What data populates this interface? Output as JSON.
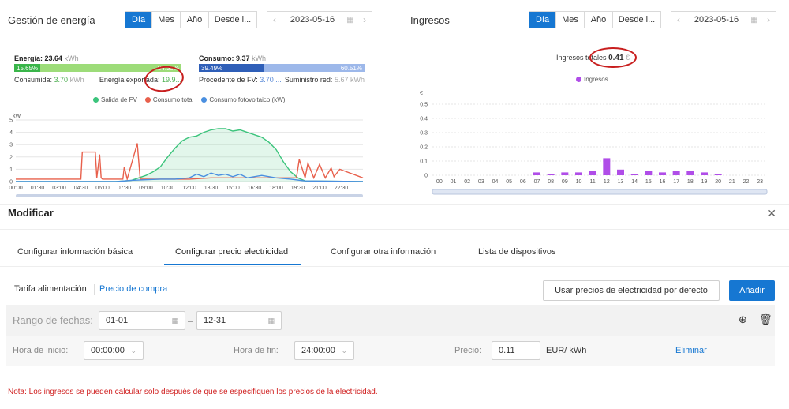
{
  "energy": {
    "title": "Gestión de energía",
    "period_tabs": [
      "Día",
      "Mes",
      "Año",
      "Desde i..."
    ],
    "active_tab": 0,
    "date": "2023-05-16",
    "energia_label": "Energía:",
    "energia_value": "23.64",
    "energia_unit": "kWh",
    "energia_bar_left": "15.65%",
    "energia_bar_right": "84.35%",
    "energia_bar_fraction": 0.1565,
    "consumida_label": "Consumida:",
    "consumida_value": "3.70",
    "consumida_unit": "kWh",
    "exportada_label": "Energía exportada:",
    "exportada_value": "19.9...",
    "consumo_label": "Consumo:",
    "consumo_value": "9.37",
    "consumo_unit": "kWh",
    "consumo_bar_left": "39.49%",
    "consumo_bar_right": "60.51%",
    "consumo_bar_fraction": 0.3949,
    "procedente_label": "Procedente de FV:",
    "procedente_value": "3.70 ...",
    "suministro_label": "Suministro red:",
    "suministro_value": "5.67",
    "suministro_unit": "kWh",
    "legend": [
      {
        "label": "Salida de FV",
        "color": "#3cc47c"
      },
      {
        "label": "Consumo total",
        "color": "#e8604c"
      },
      {
        "label": "Consumo fotovoltaico (kW)",
        "color": "#4a8fe0"
      }
    ],
    "y_unit": "kW"
  },
  "ingresos": {
    "title": "Ingresos",
    "period_tabs": [
      "Día",
      "Mes",
      "Año",
      "Desde i..."
    ],
    "active_tab": 0,
    "date": "2023-05-16",
    "total_label": "Ingresos totales",
    "total_value": "0.41",
    "total_unit": "€",
    "legend_label": "Ingresos",
    "legend_color": "#b04de8",
    "y_unit": "€"
  },
  "chart_data": [
    {
      "type": "line",
      "title": "",
      "ylabel": "kW",
      "ylim": [
        0,
        5
      ],
      "yticks": [
        0,
        1,
        2,
        3,
        4,
        5
      ],
      "x_ticks": [
        "00:00",
        "01:30",
        "03:00",
        "04:30",
        "06:00",
        "07:30",
        "09:00",
        "10:30",
        "12:00",
        "13:30",
        "15:00",
        "16:30",
        "18:00",
        "19:30",
        "21:00",
        "22:30"
      ],
      "x_hours": [
        0,
        24
      ],
      "series": [
        {
          "name": "Salida de FV",
          "color": "#3cc47c",
          "x": [
            0,
            6.9,
            7.5,
            8,
            8.5,
            9,
            9.5,
            10,
            10.5,
            11,
            11.5,
            12,
            12.5,
            13,
            13.5,
            14,
            14.5,
            15,
            15.5,
            16,
            16.5,
            17,
            17.5,
            18,
            18.5,
            19,
            19.5,
            20,
            24
          ],
          "y": [
            0,
            0,
            0.05,
            0.1,
            0.3,
            0.5,
            0.8,
            1.2,
            2.0,
            2.7,
            3.3,
            3.6,
            3.7,
            4.0,
            4.2,
            4.3,
            4.3,
            4.1,
            4.2,
            4.0,
            3.8,
            3.6,
            3.2,
            2.6,
            1.6,
            0.8,
            0.3,
            0.05,
            0
          ]
        },
        {
          "name": "Consumo total",
          "color": "#e8604c",
          "x": [
            0,
            4.5,
            4.6,
            5.5,
            5.6,
            5.8,
            5.9,
            6.0,
            7.4,
            7.5,
            7.7,
            8.4,
            8.6,
            9,
            12,
            13.5,
            15,
            16.5,
            18,
            19.4,
            19.6,
            20,
            20.2,
            20.6,
            21,
            21.4,
            21.8,
            22,
            22.4,
            24
          ],
          "y": [
            0.2,
            0.2,
            2.4,
            2.4,
            0.3,
            2.2,
            0.3,
            0.2,
            0.2,
            1.2,
            0.2,
            3.1,
            0.2,
            0.2,
            0.2,
            0.3,
            0.3,
            0.3,
            0.3,
            0.3,
            1.8,
            0.3,
            1.5,
            0.3,
            1.4,
            0.3,
            1.1,
            0.4,
            1.0,
            0.3
          ]
        },
        {
          "name": "Consumo fotovoltaico (kW)",
          "color": "#4a8fe0",
          "x": [
            0,
            7,
            8,
            9,
            10,
            11,
            12,
            12.5,
            13,
            13.5,
            14,
            14.5,
            15,
            15.5,
            16,
            17,
            18,
            19,
            20,
            24
          ],
          "y": [
            0,
            0,
            0.1,
            0.15,
            0.2,
            0.2,
            0.3,
            0.6,
            0.4,
            0.7,
            0.5,
            0.6,
            0.4,
            0.6,
            0.3,
            0.5,
            0.3,
            0.2,
            0.05,
            0
          ]
        }
      ]
    },
    {
      "type": "bar",
      "title": "",
      "ylabel": "€",
      "ylim": [
        0,
        0.5
      ],
      "yticks": [
        0,
        0.1,
        0.2,
        0.3,
        0.4,
        0.5
      ],
      "categories": [
        "00",
        "01",
        "02",
        "03",
        "04",
        "05",
        "06",
        "07",
        "08",
        "09",
        "10",
        "11",
        "12",
        "13",
        "14",
        "15",
        "16",
        "17",
        "18",
        "19",
        "20",
        "21",
        "22",
        "23"
      ],
      "series": [
        {
          "name": "Ingresos",
          "color": "#b04de8",
          "values": [
            0,
            0,
            0,
            0,
            0,
            0,
            0,
            0.02,
            0.01,
            0.02,
            0.02,
            0.03,
            0.12,
            0.04,
            0.01,
            0.03,
            0.02,
            0.03,
            0.03,
            0.02,
            0.01,
            0,
            0,
            0
          ]
        }
      ]
    }
  ],
  "modal": {
    "title": "Modificar",
    "tabs": [
      "Configurar información básica",
      "Configurar precio electricidad",
      "Configurar otra información",
      "Lista de dispositivos"
    ],
    "active_tab": 1,
    "subtab_feed": "Tarifa alimentación",
    "subtab_buy": "Precio de compra",
    "default_prices_button": "Usar precios de electricidad por defecto",
    "add_button": "Añadir",
    "date_range_label": "Rango de fechas:",
    "date_from": "01-01",
    "date_to": "12-31",
    "start_label": "Hora de inicio:",
    "start_value": "00:00:00",
    "end_label": "Hora de fin:",
    "end_value": "24:00:00",
    "price_label": "Precio:",
    "price_value": "0.11",
    "price_unit": "EUR/ kWh",
    "delete_link": "Eliminar",
    "note": "Nota: Los ingresos se pueden calcular solo después de que se especifiquen los precios de la electricidad."
  }
}
